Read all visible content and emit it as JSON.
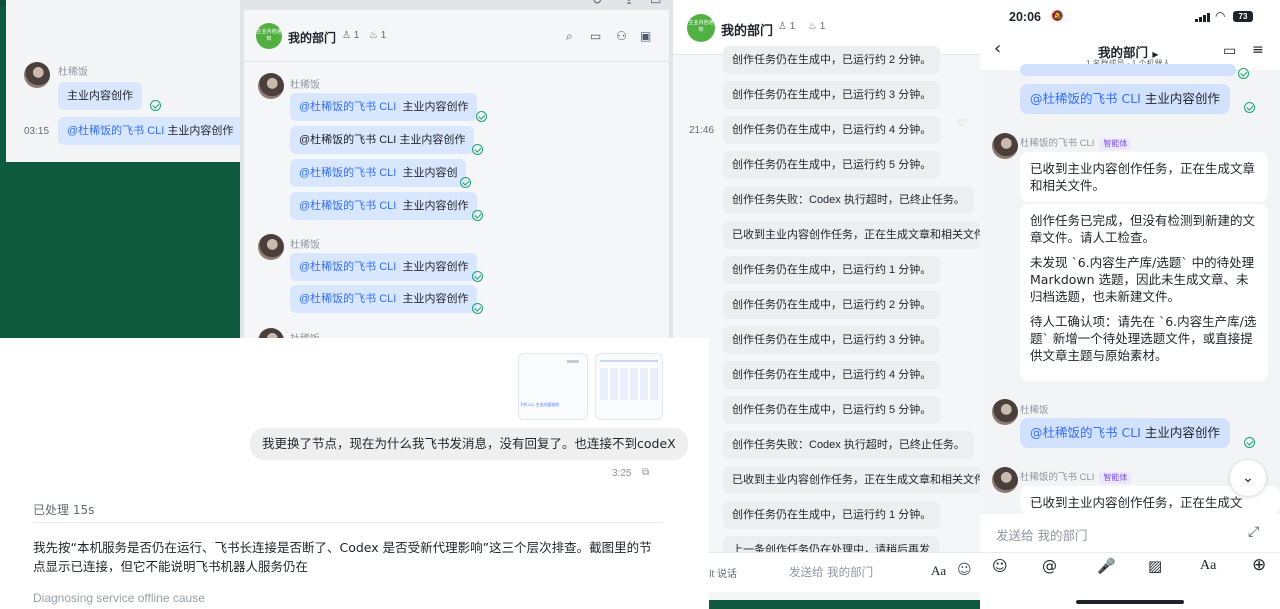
{
  "panel1": {
    "sender": "杜稀饭",
    "msg1": "主业内容创作",
    "time": "03:15",
    "msg2_mention": "@杜稀饭的飞书 CLI",
    "msg2_text": "主业内容创作"
  },
  "panel2": {
    "title": "我的部门",
    "members": "1",
    "bots": "1",
    "avatar_text": "主业内容通知",
    "sender": "杜稀饭",
    "msgs_group1": [
      {
        "mention": "@杜稀饭的飞书 CLI",
        "text": "主业内容创作"
      },
      {
        "mention": "",
        "text": "@杜稀饭的飞书 CLI  主业内容创作"
      },
      {
        "mention": "@杜稀饭的飞书 CLI",
        "text": "主业内容创"
      },
      {
        "mention": "@杜稀饭的飞书 CLI",
        "text": "主业内容创作"
      }
    ],
    "msgs_group2": [
      {
        "mention": "@杜稀饭的飞书 CLI",
        "text": "主业内容创作"
      },
      {
        "mention": "@杜稀饭的飞书 CLI",
        "text": "主业内容创作"
      }
    ],
    "sender3": "杜稀饭"
  },
  "panel3": {
    "title": "我的部门",
    "members": "1",
    "bots": "1",
    "time": "21:46",
    "messages": [
      "创作任务仍在生成中，已运行约 2 分钟。",
      "创作任务仍在生成中，已运行约 3 分钟。",
      "创作任务仍在生成中，已运行约 4 分钟。",
      "创作任务仍在生成中，已运行约 5 分钟。",
      "创作任务失败：Codex 执行超时，已终止任务。",
      "已收到主业内容创作任务，正在生成文章和相关文件",
      "创作任务仍在生成中，已运行约 1 分钟。",
      "创作任务仍在生成中，已运行约 2 分钟。",
      "创作任务仍在生成中，已运行约 3 分钟。",
      "创作任务仍在生成中，已运行约 4 分钟。",
      "创作任务仍在生成中，已运行约 5 分钟。",
      "创作任务失败：Codex 执行超时，已终止任务。",
      "已收到主业内容创作任务，正在生成文章和相关文件",
      "创作任务仍在生成中，已运行约 1 分钟。",
      "上一条创作任务仍在处理中，请稍后再发"
    ],
    "input_left": "按住 右 Alt 说话",
    "input_placeholder": "发送给 我的部门"
  },
  "panel4": {
    "status_time": "20:06",
    "battery": "73",
    "title": "我的部门",
    "subtitle": "1 名群成员 · 1 个机器人",
    "top_msg_mention": "@杜稀饭的飞书 CLI",
    "top_msg_text": "主业内容创作",
    "bot_name": "杜稀饭的飞书 CLI",
    "bot_badge": "智能体",
    "bot_msg1": "已收到主业内容创作任务，正在生成文章和相关文件。",
    "bot_msg2_p1": "创作任务已完成，但没有检测到新建的文章文件。请人工检查。",
    "bot_msg2_p2": "未发现 `6.内容生产库/选题` 中的待处理 Markdown 选题，因此未生成文章、未归档选题，也未新建文件。",
    "bot_msg2_p3": "待人工确认项：请先在 `6.内容生产库/选题` 新增一个待处理选题文件，或直接提供文章主题与原始素材。",
    "user_name": "杜稀饭",
    "user_msg_mention": "@杜稀饭的飞书 CLI",
    "user_msg_text": "主业内容创作",
    "bot_name2": "杜稀饭的飞书 CLI",
    "bot_badge2": "智能体",
    "bot_msg3": "已收到主业内容创作任务，正在生成文",
    "input_placeholder": "发送给 我的部门"
  },
  "panel5": {
    "user_msg": "我更换了节点，现在为什么我飞书发消息，没有回复了。也连接不到codeX",
    "time": "3:25",
    "processed": "已处理 15s",
    "reply": "我先按“本机服务是否仍在运行、飞书长连接是否断了、Codex 是否受新代理影响”这三个层次排查。截图里的节点显示已连接，但它不能说明飞书机器人服务仍在",
    "status_line": "Diagnosing service offline cause",
    "thumb1_text": "飞书 CLI 主业内容创作"
  }
}
